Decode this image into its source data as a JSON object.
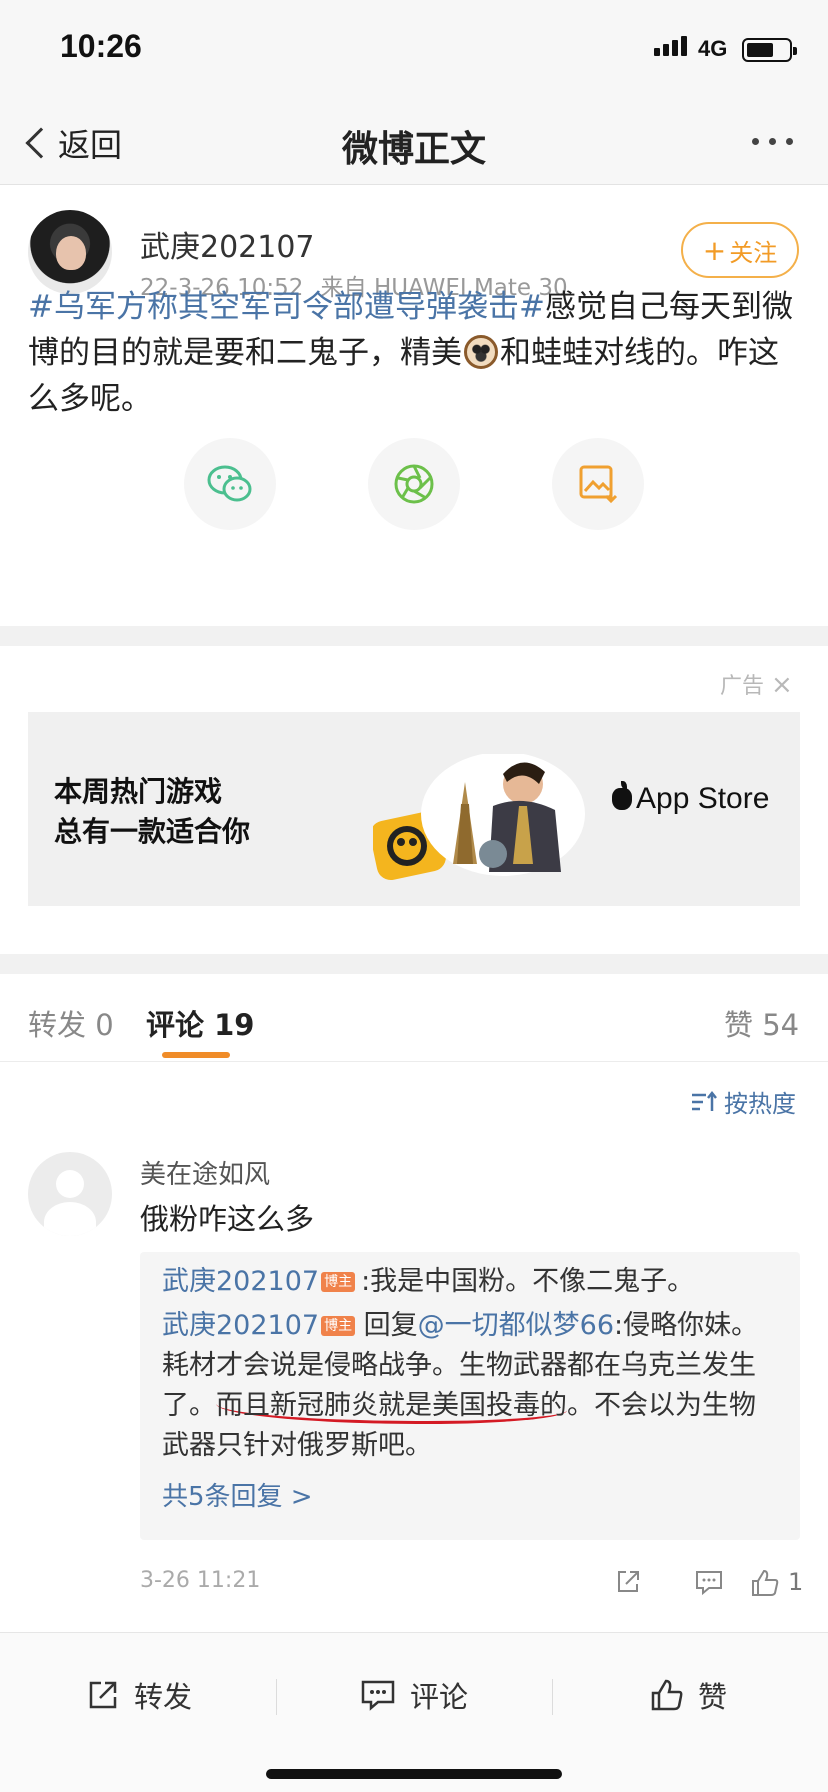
{
  "status_bar": {
    "time": "10:26",
    "network": "4G"
  },
  "nav": {
    "back_label": "返回",
    "title": "微博正文"
  },
  "post": {
    "author": "武庚202107",
    "time": "22-3-26 10:52",
    "source": "来自 HUAWEI Mate 30",
    "follow_label": "关注",
    "follow_plus": "+",
    "hashtag": "#乌军方称其空军司令部遭导弹袭击#",
    "text_part1": "感觉自己每天到微博的目的就是要和二鬼子，精美",
    "text_part2": "和蛙蛙对线的。咋这么多呢。",
    "share_targets": [
      "wechat-icon",
      "moments-icon",
      "save-image-icon"
    ]
  },
  "ad": {
    "label": "广告",
    "close": "×",
    "line1": "本周热门游戏",
    "line2": "总有一款适合你",
    "store": "App Store"
  },
  "tabs": {
    "repost": "转发 0",
    "comment": "评论 19",
    "like": "赞 54"
  },
  "sort": {
    "label": "按热度"
  },
  "comment": {
    "name": "美在途如风",
    "text": "俄粉咋这么多",
    "replies": [
      {
        "author": "武庚202107",
        "badge": "博主",
        "text": ":我是中国粉。不像二鬼子。"
      },
      {
        "author": "武庚202107",
        "badge": "博主",
        "reply_to_prefix": "回复",
        "mention": "@一切都似梦66",
        "text_a": ":侵略你妹。耗材才会说是侵略战争。生物武器都在乌克兰发生了。",
        "text_marked": "而且新冠肺炎就是美国投毒的",
        "text_b": "。不会以为生物武器只针对俄罗斯吧。"
      }
    ],
    "more_replies": "共5条回复 >",
    "time": "3-26 11:21",
    "like_count": "1"
  },
  "bottom_bar": {
    "repost": "转发",
    "comment": "评论",
    "like": "赞"
  },
  "colors": {
    "accent": "#f08c28",
    "link": "#4a74a6",
    "mark": "#d41a24"
  }
}
